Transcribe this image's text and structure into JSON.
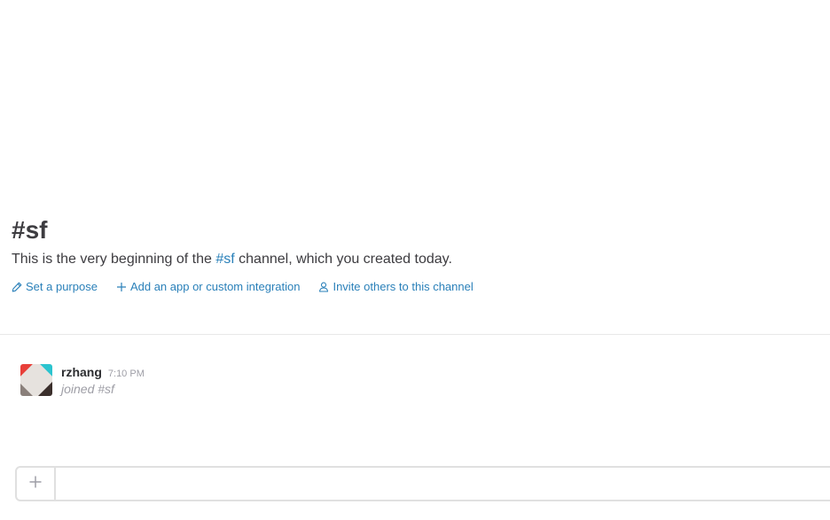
{
  "channel": {
    "title": "#sf",
    "intro_before": "This is the very beginning of the ",
    "intro_link": "#sf",
    "intro_after": " channel, which you created today."
  },
  "actions": [
    {
      "label": "Set a purpose",
      "icon": "pencil-icon"
    },
    {
      "label": "Add an app or custom integration",
      "icon": "plus-icon"
    },
    {
      "label": "Invite others to this channel",
      "icon": "user-icon"
    }
  ],
  "message": {
    "author": "rzhang",
    "time": "7:10 PM",
    "text": "joined #sf",
    "avatar_colors": [
      "#e8403a",
      "#2bc4cf",
      "#e6e2de",
      "#3b2f2c"
    ]
  },
  "composer": {
    "plus_icon": "plus-icon",
    "placeholder": "",
    "value": ""
  },
  "colors": {
    "link": "#2a80b9",
    "muted": "#9e9ea6",
    "border": "#e0e0e0"
  }
}
